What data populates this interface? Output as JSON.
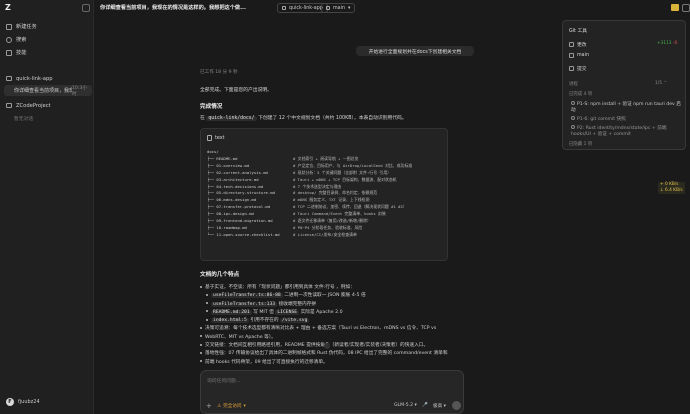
{
  "sidebar": {
    "logo": "Z",
    "nav": [
      {
        "label": "新建任务"
      },
      {
        "label": "搜索"
      },
      {
        "label": "技能"
      }
    ],
    "projects": [
      {
        "label": "quick-link-app",
        "threads": [
          {
            "label": "你详细查看当前项目，我现在...",
            "time": "10:3小时"
          }
        ]
      },
      {
        "label": "ZCodeProject",
        "threads": []
      }
    ],
    "empty_thread_text": "暂无对话",
    "user": {
      "initial": "F",
      "name": "fjuubz24"
    }
  },
  "topbar": {
    "title": "你详细查看当前项目，我现在的情况是这样的。我想把这个做...",
    "project_pill": "quick-link-app",
    "branch_pill": "main"
  },
  "chat": {
    "user_message": "开始进行全面规划并在docs下创建相关文档",
    "meta": "已工作 18 分 9 秒",
    "intro": "全部完成。下面是您的产出说明。",
    "heading1": "完成情况",
    "summary": {
      "before": "在",
      "path": "quick-link/docs/",
      "after": "下创建了 12 个中文规划文档（共约 100KB），本表自动识别用代码。"
    },
    "code_block": {
      "lang": "text",
      "lines": [
        {
          "t": "docs/",
          "c": ""
        },
        {
          "t": "├── README.md",
          "c": "# 文档索引 + 阅读导航 + 一图总览"
        },
        {
          "t": "├── 01-overview.md",
          "c": "# 产品定位、目标用户、与 AirDrop/LocalSend 对比、成功标准"
        },
        {
          "t": "├── 02-current-analysis.md",
          "c": "# 现状分析：5 个关键问题（全部附 文件:行号 引用）"
        },
        {
          "t": "├── 03-architecture.md",
          "c": "# Tauri + mDNS + TCP 目标架构、数据流、配对状态机"
        },
        {
          "t": "├── 04-tech-decisions.md",
          "c": "# 7 个技术选型决定与理由"
        },
        {
          "t": "├── 05-directory-structure.md",
          "c": "# desktop/ 完整目录树、命名约定、依赖规范"
        },
        {
          "t": "├── 06-mdns-design.md",
          "c": "# mDNS 服务定义、TXT 记录、上下线检测"
        },
        {
          "t": "├── 07-transfer-protocol.md",
          "c": "# TCP 二进制协议、加密、续传、回退（解决现状问题 #1 #2）"
        },
        {
          "t": "├── 08-ipc-design.md",
          "c": "# Tauri Command/Event 完整清单、hooks 封装"
        },
        {
          "t": "├── 09-frontend-migration.md",
          "c": "# 逐文件迁移清单（复用/改造/新增/删除）"
        },
        {
          "t": "├── 10-roadmap.md",
          "c": "# P0~P4 分阶段任务、验收标准、风险"
        },
        {
          "t": "└── 11-open-source-checklist.md",
          "c": "# License/CI/发布/安全检查清单"
        }
      ]
    },
    "heading2": "文档的几个特点",
    "bullets": [
      {
        "text": "基于实证，不空谈：所有「现状问题」都引用到具体 文件:行号 ，例如："
      },
      {
        "sub": true,
        "code": "useFileTransfer.ts:86-88",
        "text": "二进制一次性读取一 JSON 膨胀 4-5 倍"
      },
      {
        "sub": true,
        "code": "useFileTransfer.ts:133",
        "text": "接收端完整内存拼"
      },
      {
        "sub": true,
        "code": "README.md:201",
        "text": "写 MIT 但",
        "code2": "LICENSE",
        "text2": "实际是 Apache 2.0"
      },
      {
        "sub": true,
        "code": "index.html:5",
        "text": "引用不存在的",
        "code2": "/vite.svg"
      },
      {
        "text": "决策可追溯：每个技术选型都有清晰对比表 + 理由 + 备选方案（Tauri vs Electron、mDNS vs 信令、TCP vs"
      },
      {
        "text": "WebRTC、MIT vs Apache 等）。"
      },
      {
        "text": "交叉链接：文档间互相引用路径引用，README 提供按角色（新读者/实现者/实装者/决策者）的快速入口。"
      },
      {
        "text": "落地性强：07 传输协议给出了具体的二进制帧格式和 Rust 伪代码，08 IPC 给出了完整的 command/event 清单和"
      },
      {
        "text": "前端 hooks 代码骨架，09 给出了可直接执行的迁移清单。"
      }
    ]
  },
  "composer": {
    "placeholder": "询问任何问题...",
    "plus": "+",
    "access_label": "完全访问",
    "model": "GLM-5.2",
    "mic": "🎤",
    "reasoning": "极高"
  },
  "git_panel": {
    "title": "Git 工具",
    "rows": [
      {
        "label": "更改"
      },
      {
        "label": "main"
      },
      {
        "label": "提交"
      }
    ],
    "additions": "+3113",
    "deletions": "-0",
    "section_label": "进程",
    "collapse_label": "1/5 ⌃",
    "tasks_summary": "已完成 4 项",
    "tasks": [
      {
        "text": "P1-S: npm install + 验证 npm run tauri dev 启动",
        "done": true
      },
      {
        "text": "P1-6: git commit 快照",
        "done": false
      },
      {
        "text": "P2: Rust identity/mdns/state/ipc + 前端 hooks/UI + 验证 + commit",
        "done": false
      }
    ],
    "more": "已隐藏 1 项"
  },
  "side_badge": {
    "line1": "+ 0 KB/s",
    "line2": "↓ 6.4 KB/s"
  }
}
